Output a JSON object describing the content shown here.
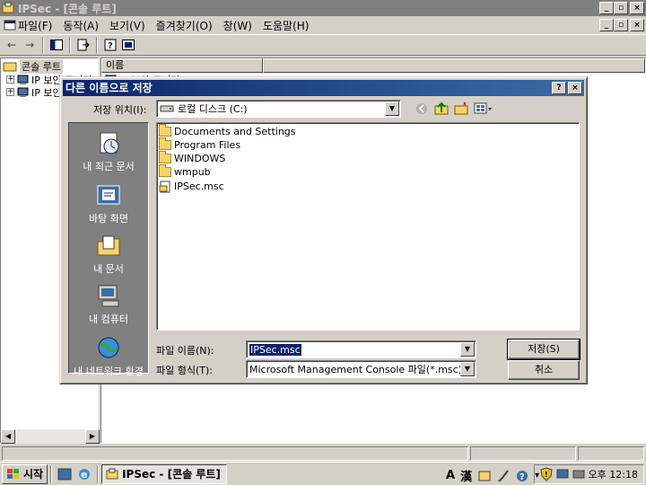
{
  "window": {
    "title": "IPSec - [콘솔 루트]"
  },
  "menu": [
    "파일(F)",
    "동작(A)",
    "보기(V)",
    "즐겨찾기(O)",
    "창(W)",
    "도움말(H)"
  ],
  "tree": {
    "root": "콘솔 루트",
    "items": [
      "IP 보안 모니터",
      "IP 보안 정책"
    ]
  },
  "list": {
    "column_name": "이름",
    "partial_row": "IP 보안 모니터"
  },
  "dialog": {
    "title": "다른 이름으로 저장",
    "save_in_label": "저장 위치(I):",
    "save_in_value": "로컬 디스크 (C:)",
    "places": [
      "내 최근 문서",
      "바탕 화면",
      "내 문서",
      "내 컴퓨터",
      "내 네트워크 환경"
    ],
    "files": [
      {
        "name": "Documents and Settings",
        "type": "folder"
      },
      {
        "name": "Program Files",
        "type": "folder"
      },
      {
        "name": "WINDOWS",
        "type": "folder"
      },
      {
        "name": "wmpub",
        "type": "folder"
      },
      {
        "name": "IPSec.msc",
        "type": "msc"
      }
    ],
    "filename_label": "파일 이름(N):",
    "filename_value": "IPSec.msc",
    "filetype_label": "파일 형식(T):",
    "filetype_value": "Microsoft Management Console 파일(*.msc)",
    "save_button": "저장(S)",
    "cancel_button": "취소"
  },
  "taskbar": {
    "start": "시작",
    "task": "IPSec - [콘솔 루트]",
    "lang_a": "A",
    "lang_han": "漢",
    "clock": "오후 12:18"
  },
  "colors": {
    "title_active": "#0a246a",
    "title_active_end": "#3a6ea5",
    "title_inactive": "#808080",
    "face": "#d4d0c8"
  }
}
